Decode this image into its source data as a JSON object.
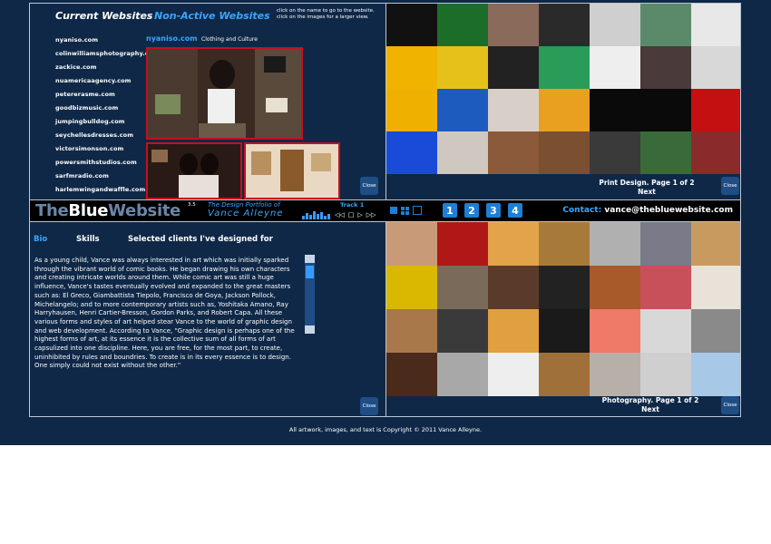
{
  "websites": {
    "tab_current": "Current Websites",
    "tab_nonactive": "Non-Active Websites",
    "hint_line1": "click on the name to go to the website.",
    "hint_line2": "click on the images for a larger view.",
    "sites": [
      "nyaniso.com",
      "colinwilliamsphotography.com",
      "zackice.com",
      "nuamericaagency.com",
      "petererasme.com",
      "goodbizmusic.com",
      "jumpingbulldog.com",
      "seychellesdresses.com",
      "victorsimonson.com",
      "powersmithstudios.com",
      "sarfmradio.com",
      "harlemwingandwaffle.com"
    ],
    "featured_name": "nyaniso.com",
    "featured_category": "Clothing and Culture",
    "close_label": "Close"
  },
  "print": {
    "pager_line1": "Print Design. Page 1 of 2",
    "pager_line2": "Next",
    "close_label": "Close",
    "tile_colors": [
      "#111111",
      "#1d6d2a",
      "#8a6a5a",
      "#2a2a2a",
      "#cfcfcf",
      "#5a8a6a",
      "#e8e8e8",
      "#f0b400",
      "#e5c21a",
      "#222222",
      "#2a9b58",
      "#eeeeee",
      "#4a3a3a",
      "#d8d8d8",
      "#f0b000",
      "#1e5bbf",
      "#d8d0c8",
      "#e9a020",
      "#0a0a0a",
      "#0a0a0a",
      "#c41010",
      "#1a4ad8",
      "#cfc8c0",
      "#8a5a3a",
      "#7a5030",
      "#3a3a3a",
      "#3a6a3a",
      "#8a2a2a"
    ]
  },
  "banner": {
    "logo_part1": "The",
    "logo_part2": "Blue",
    "logo_part3": "Website",
    "logo_sup": "3.5",
    "tagline": "The Design Portfolio of",
    "owner": "Vance Alleyne",
    "track": "Track 1",
    "pages": [
      "1",
      "2",
      "3",
      "4"
    ],
    "contact_label": "Contact:",
    "contact_email": "vance@thebluewebsite.com"
  },
  "bio": {
    "tabs": [
      "Bio",
      "Skills",
      "Selected clients I've designed for"
    ],
    "text": "As a young child, Vance was always interested in art which was initially sparked through the vibrant world of comic books. He began drawing his own characters and creating intricate worlds around them. While comic art was still a huge influence, Vance's tastes eventually evolved and expanded to the great masters such as: El Greco, Giambattista Tiepolo, Francisco de Goya, Jackson Pollock, Michelangelo; and to more contemporary artists such as, Yoshitaka Amano, Ray Harryhausen, Henri Cartier-Bresson, Gordon Parks, and Robert Capa. All these various forms and styles of art helped stear Vance to the world of graphic design and web development. According to Vance, \"Graphic design is perhaps one of the highest forms of art, at its essence it is the collective sum of all forms of art capsulized into one discipline. Here, you are free, for the most part, to create, uninhibited by rules and boundries. To create is in its every essence is to design. One simply could not exist without the other.\"",
    "close_label": "Close"
  },
  "photo": {
    "pager_line1": "Photography. Page 1 of 2",
    "pager_line2": "Next",
    "close_label": "Close",
    "tile_colors": [
      "#c89a78",
      "#b01818",
      "#e3a34a",
      "#a87a3a",
      "#b0b0b0",
      "#7a7a88",
      "#c89a60",
      "#d8b800",
      "#7a6a5a",
      "#5a3a2a",
      "#222222",
      "#a85a2a",
      "#c8505a",
      "#e8e2d8",
      "#a8784a",
      "#3a3a3a",
      "#e0a040",
      "#1a1a1a",
      "#f07a68",
      "#d8d8d8",
      "#8a8a8a",
      "#4a2a1a",
      "#a8a8a8",
      "#eeeeee",
      "#a0703a",
      "#b8b0a8",
      "#cfcfcf",
      "#a8c8e8"
    ]
  },
  "footer": {
    "copyright": "All artwork, images, and text is Copyright © 2011 Vance Alleyne."
  }
}
